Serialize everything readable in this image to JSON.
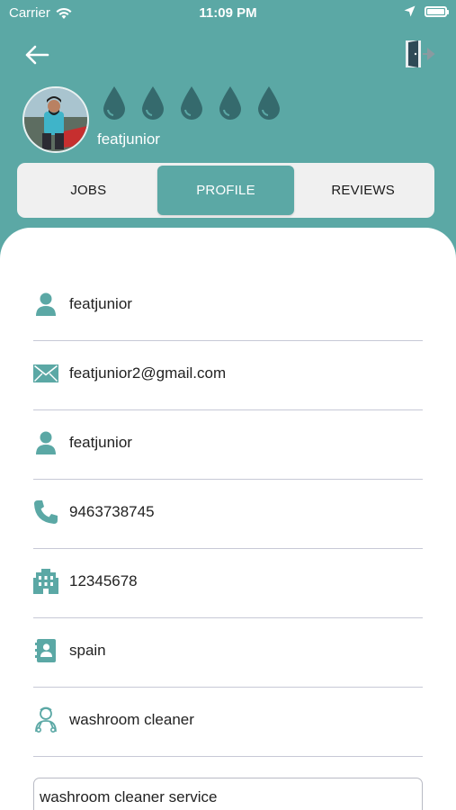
{
  "status_bar": {
    "carrier": "Carrier",
    "time": "11:09 PM"
  },
  "profile": {
    "username": "featjunior",
    "rating_drops": 5,
    "accent_color": "#5ba8a5"
  },
  "tabs": [
    {
      "label": "JOBS",
      "active": false
    },
    {
      "label": "PROFILE",
      "active": true
    },
    {
      "label": "REVIEWS",
      "active": false
    }
  ],
  "fields": [
    {
      "icon": "person-icon",
      "value": "featjunior"
    },
    {
      "icon": "mail-icon",
      "value": "featjunior2@gmail.com"
    },
    {
      "icon": "person-icon",
      "value": "featjunior"
    },
    {
      "icon": "phone-icon",
      "value": "9463738745"
    },
    {
      "icon": "building-icon",
      "value": "12345678"
    },
    {
      "icon": "contact-card-icon",
      "value": "spain"
    },
    {
      "icon": "worker-icon",
      "value": "washroom cleaner"
    }
  ],
  "description": "washroom cleaner service"
}
